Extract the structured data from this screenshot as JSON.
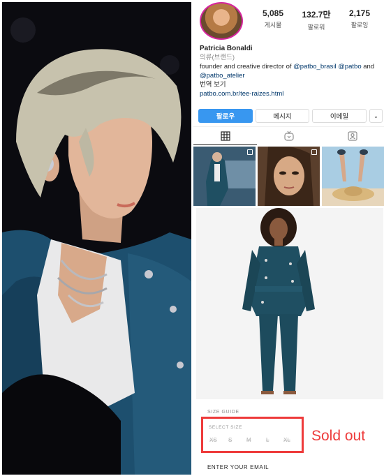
{
  "profile": {
    "stats": {
      "posts": {
        "value": "5,085",
        "label": "게시물"
      },
      "followers": {
        "value": "132.7만",
        "label": "팔로워"
      },
      "following": {
        "value": "2,175",
        "label": "팔로잉"
      }
    },
    "name": "Patricia Bonaldi",
    "category": "의류(브랜드)",
    "bio_text_1": "founder and creative director of",
    "mention_1": "@patbo_brasil",
    "mention_2": "@patbo",
    "bio_text_2": "and",
    "mention_3": "@patbo_atelier",
    "translate": "번역 보기",
    "link": "patbo.com.br/tee-raizes.html"
  },
  "actions": {
    "follow": "팔로우",
    "message": "메시지",
    "email": "이메일",
    "more": "⌄"
  },
  "tabs": [
    {
      "name": "grid",
      "icon": "grid-icon"
    },
    {
      "name": "igtv",
      "icon": "igtv-icon"
    },
    {
      "name": "tagged",
      "icon": "tagged-icon"
    }
  ],
  "product": {
    "size_guide": "SIZE GUIDE",
    "select_size": "SELECT SIZE",
    "sizes": [
      "XS",
      "S",
      "M",
      "L",
      "XL"
    ],
    "sold_out": "Sold out",
    "enter_email": "ENTER YOUR EMAIL"
  },
  "colors": {
    "accent_blue": "#3897f0",
    "sold_out_red": "#ee3b3b",
    "velvet_teal": "#1f4f62"
  }
}
